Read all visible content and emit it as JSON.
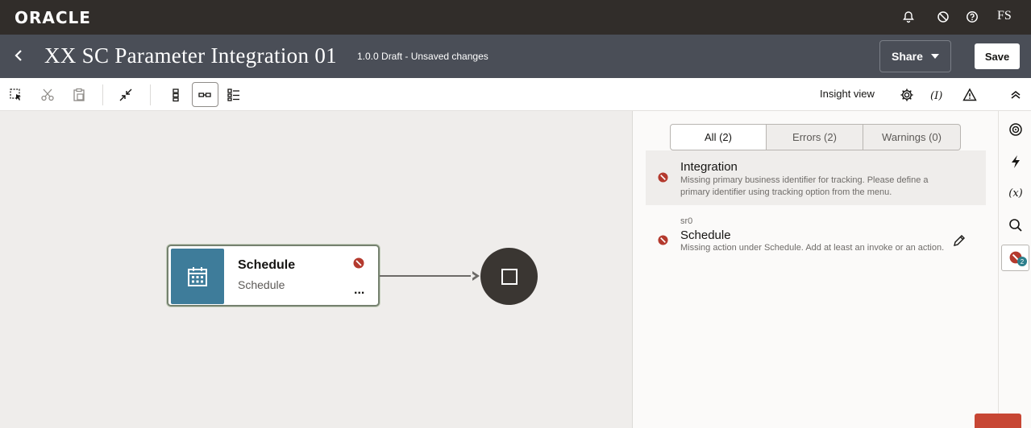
{
  "brand": {
    "logo": "ORACLE",
    "user_initials": "FS"
  },
  "top_icons": [
    "bell-icon",
    "no-entry-icon",
    "help-icon"
  ],
  "header": {
    "title": "XX SC Parameter Integration 01",
    "version": "1.0.0 Draft - Unsaved changes",
    "share_label": "Share",
    "save_label": "Save"
  },
  "toolbar": {
    "insight_label": "Insight view",
    "icons": [
      "select-icon",
      "cut-icon",
      "paste-icon",
      "collapse-icon",
      "vertical-layout-icon",
      "horizontal-layout-icon",
      "pseudo-layout-icon",
      "gear-icon",
      "variables-icon",
      "warning-icon"
    ]
  },
  "canvas": {
    "node": {
      "title": "Schedule",
      "subtitle": "Schedule",
      "more": "..."
    }
  },
  "panel": {
    "tabs": [
      {
        "label": "All (2)"
      },
      {
        "label": "Errors (2)"
      },
      {
        "label": "Warnings (0)"
      }
    ],
    "issues": [
      {
        "kicker": "",
        "title": "Integration",
        "description": "Missing primary business identifier for tracking. Please define a primary identifier using tracking option from the menu."
      },
      {
        "kicker": "sr0",
        "title": "Schedule",
        "description": "Missing action under Schedule. Add at least an invoke or an action."
      }
    ]
  },
  "rail": {
    "variables_label": "(x)",
    "error_count": "2"
  },
  "colors": {
    "brand_bar": "#312d2a",
    "header_bar": "#4a4e57",
    "error_red": "#b43a2e",
    "node_tile": "#3e7c9a",
    "badge": "#2c7f8c"
  }
}
